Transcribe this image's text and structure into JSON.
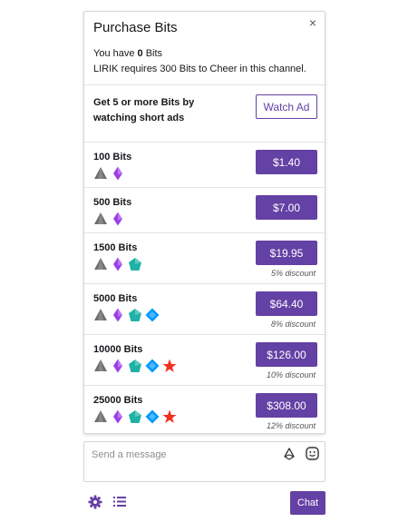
{
  "panel": {
    "title": "Purchase Bits",
    "balance_prefix": "You have ",
    "balance_value": "0",
    "balance_suffix": " Bits",
    "requirement": "LIRIK requires 300 Bits to Cheer in this channel.",
    "ad_text": "Get 5 or more Bits by watching short ads",
    "watch_ad_label": "Watch Ad",
    "close_label": "×"
  },
  "packages": [
    {
      "label": "100 Bits",
      "price": "$1.40",
      "discount": "",
      "gems": [
        "gray",
        "purple"
      ]
    },
    {
      "label": "500 Bits",
      "price": "$7.00",
      "discount": "",
      "gems": [
        "gray",
        "purple"
      ]
    },
    {
      "label": "1500 Bits",
      "price": "$19.95",
      "discount": "5% discount",
      "gems": [
        "gray",
        "purple",
        "green"
      ]
    },
    {
      "label": "5000 Bits",
      "price": "$64.40",
      "discount": "8% discount",
      "gems": [
        "gray",
        "purple",
        "green",
        "blue"
      ]
    },
    {
      "label": "10000 Bits",
      "price": "$126.00",
      "discount": "10% discount",
      "gems": [
        "gray",
        "purple",
        "green",
        "blue",
        "red"
      ]
    },
    {
      "label": "25000 Bits",
      "price": "$308.00",
      "discount": "12% discount",
      "gems": [
        "gray",
        "purple",
        "green",
        "blue",
        "red"
      ]
    }
  ],
  "chat": {
    "placeholder": "Send a message",
    "send_label": "Chat"
  },
  "icons": {
    "close": "close-icon",
    "bits": "bits-icon",
    "emote": "emote-icon",
    "settings": "gear-icon",
    "list": "list-icon"
  },
  "colors": {
    "accent": "#6441a4",
    "gem_gray": "#6e6e72",
    "gem_purple": "#9c3ee8",
    "gem_green": "#1db2a5",
    "gem_blue": "#0099fe",
    "gem_red": "#f43021"
  }
}
